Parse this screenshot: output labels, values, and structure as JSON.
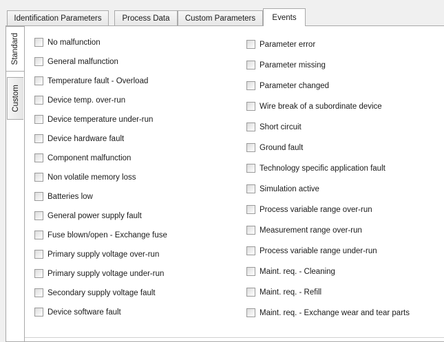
{
  "tabs": [
    "Identification Parameters",
    "Process Data",
    "Custom Parameters",
    "Events"
  ],
  "side_tabs": [
    "Standard",
    "Custom"
  ],
  "events_left": [
    "No malfunction",
    "General malfunction",
    "Temperature fault - Overload",
    "Device temp. over-run",
    "Device temperature under-run",
    "Device hardware fault",
    "Component malfunction",
    "Non volatile memory loss",
    "Batteries low",
    "General power supply fault",
    "Fuse blown/open - Exchange fuse",
    "Primary supply voltage over-run",
    "Primary supply voltage under-run",
    "Secondary supply voltage fault",
    "Device software fault"
  ],
  "events_right": [
    "Parameter error",
    "Parameter missing",
    "Parameter changed",
    "Wire break of a subordinate device",
    "Short circuit",
    "Ground fault",
    "Technology specific application fault",
    "Simulation active",
    "Process variable range over-run",
    "Measurement range over-run",
    "Process variable range under-run",
    "Maint. req. - Cleaning",
    "Maint. req. - Refill",
    "Maint. req. - Exchange wear and tear parts"
  ]
}
